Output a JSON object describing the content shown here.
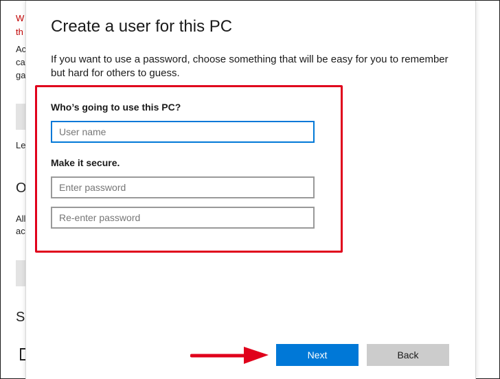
{
  "background": {
    "fragments": [
      "W",
      "th",
      "Ac",
      "ca",
      "ga",
      "Le",
      "O",
      "All",
      "ac",
      "Se"
    ]
  },
  "dialog": {
    "title": "Create a user for this PC",
    "description": "If you want to use a password, choose something that will be easy for you to remember but hard for others to guess.",
    "user_label": "Who’s going to use this PC?",
    "username_placeholder": "User name",
    "secure_label": "Make it secure.",
    "password_placeholder": "Enter password",
    "reenter_placeholder": "Re-enter password",
    "next_label": "Next",
    "back_label": "Back"
  },
  "colors": {
    "accent": "#0078d7",
    "highlight": "#e0001b"
  }
}
